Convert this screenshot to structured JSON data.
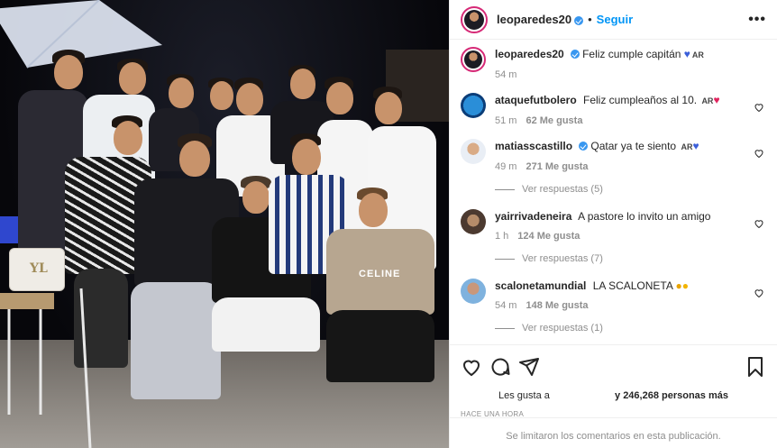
{
  "post": {
    "username": "leoparedes20",
    "follow_label": "Seguir",
    "more_label": "•••",
    "dot": "•"
  },
  "caption": {
    "username": "leoparedes20",
    "text": "Feliz cumple capitán",
    "flag": "AR",
    "time": "54 m"
  },
  "comments": [
    {
      "username": "ataquefutbolero",
      "text": "Feliz cumpleaños al 10.",
      "flag": "AR",
      "time": "51 m",
      "likes": "62 Me gusta",
      "verified": false,
      "replies": ""
    },
    {
      "username": "matiasscastillo",
      "text": "Qatar ya te siento",
      "flag": "AR",
      "time": "49 m",
      "likes": "271 Me gusta",
      "verified": true,
      "replies": "Ver respuestas (5)"
    },
    {
      "username": "yairrivadeneira",
      "text": "A pastore lo invito un amigo",
      "flag": "",
      "time": "1 h",
      "likes": "124 Me gusta",
      "verified": false,
      "replies": "Ver respuestas (7)"
    },
    {
      "username": "scalonetamundial",
      "text": "LA SCALONETA",
      "flag": "",
      "time": "54 m",
      "likes": "148 Me gusta",
      "verified": false,
      "replies": "Ver respuestas (1)"
    }
  ],
  "footer": {
    "likes_prefix": "Les gusta a",
    "likes_suffix": "y 246,268 personas más",
    "time_ago": "HACE UNA HORA",
    "limited": "Se limitaron los comentarios en esta publicación."
  },
  "photo": {
    "bag_logo": "YL",
    "shirt_text": "CELINE"
  },
  "colors": {
    "accent": "#0095f6",
    "verified": "#3897f0",
    "muted": "#8e8e8e"
  },
  "icons": [
    "heart-icon",
    "comment-icon",
    "share-icon",
    "bookmark-icon",
    "verified-icon",
    "more-icon"
  ]
}
